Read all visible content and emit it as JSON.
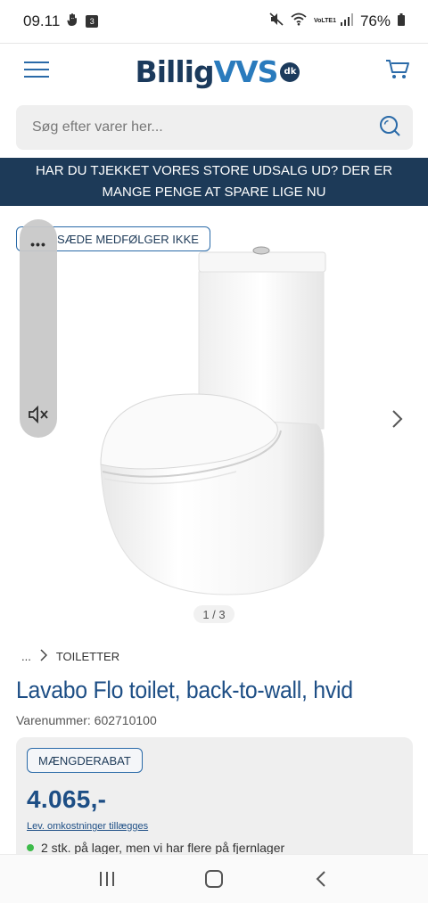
{
  "status_bar": {
    "time": "09.11",
    "notification_count": "3",
    "network_label_1": "VoLTE1",
    "battery": "76%"
  },
  "header": {
    "logo_part1": "Billig",
    "logo_part2": "VVS",
    "logo_badge": "dk",
    "menu_icon": "hamburger-icon",
    "cart_icon": "cart-icon"
  },
  "search": {
    "placeholder": "Søg efter varer her..."
  },
  "banner": {
    "text": "HAR DU TJEKKET VORES STORE UDSALG UD? DER ER MANGE PENGE AT SPARE LIGE NU"
  },
  "gallery": {
    "badge": "SÆDE MEDFØLGER IKKE",
    "overlay_dots": "•••",
    "counter": "1 / 3"
  },
  "breadcrumb": {
    "ellipsis": "...",
    "category": "TOILETTER"
  },
  "product": {
    "title": "Lavabo Flo toilet, back-to-wall, hvid",
    "sku": "Varenummer: 602710100",
    "discount_badge": "MÆNGDERABAT",
    "price": "4.065,-",
    "shipping_link": "Lev. omkostninger tillægges",
    "stock_text": "2 stk. på lager, men vi har flere på fjernlager"
  },
  "colors": {
    "brand_dark": "#1d3a58",
    "brand_blue": "#2a7bbd",
    "title_blue": "#1d4e85",
    "stock_green": "#3dbb4a"
  }
}
